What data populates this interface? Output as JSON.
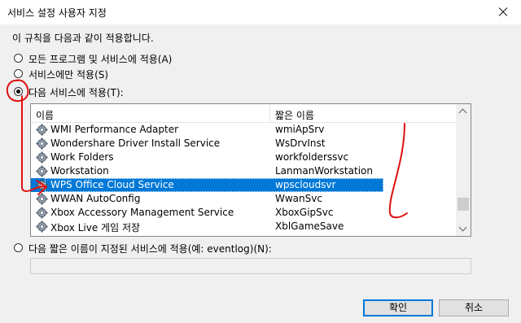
{
  "window": {
    "title": "서비스 설정 사용자 지정"
  },
  "instruction": "이 규칙을 다음과 같이 적용합니다.",
  "options": {
    "all_programs": "모든 프로그램 및 서비스에 적용(A)",
    "services_only": "서비스에만 적용(S)",
    "apply_service": "다음 서비스에 적용(T):",
    "short_name": "다음 짧은 이름이 지정된 서비스에 적용(예: eventlog)(N):"
  },
  "selected_option": "apply_service",
  "list": {
    "header_name": "이름",
    "header_short": "짧은 이름",
    "rows": [
      {
        "name": "WMI Performance Adapter",
        "short": "wmiApSrv"
      },
      {
        "name": "Wondershare Driver Install Service",
        "short": "WsDrvInst"
      },
      {
        "name": "Work Folders",
        "short": "workfolderssvc"
      },
      {
        "name": "Workstation",
        "short": "LanmanWorkstation"
      },
      {
        "name": "WPS Office Cloud Service",
        "short": "wpscloudsvr"
      },
      {
        "name": "WWAN AutoConfig",
        "short": "WwanSvc"
      },
      {
        "name": "Xbox Accessory Management Service",
        "short": "XboxGipSvc"
      },
      {
        "name": "Xbox Live 게임 저장",
        "short": "XblGameSave"
      }
    ],
    "selected_row": "WPS Office Cloud Service"
  },
  "short_name_value": "",
  "buttons": {
    "ok": "확인",
    "cancel": "취소"
  },
  "colors": {
    "selection": "#0078d7",
    "annotation": "#e01010"
  }
}
